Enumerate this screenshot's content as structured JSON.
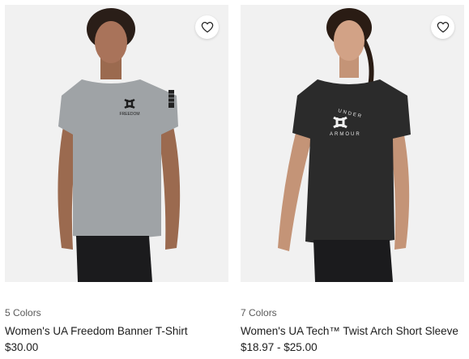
{
  "products": [
    {
      "colors_label": "5 Colors",
      "name": "Women's UA Freedom Banner T-Shirt",
      "price": "$30.00",
      "shirt_color": "#9fa3a6",
      "shirt_print": "FREEDOM",
      "wishlist_icon": "heart-icon"
    },
    {
      "colors_label": "7 Colors",
      "name": "Women's UA Tech™ Twist Arch Short Sleeve",
      "price": "$18.97 - $25.00",
      "shirt_color": "#2b2b2b",
      "shirt_print": [
        "UNDER",
        "ARMOUR"
      ],
      "wishlist_icon": "heart-icon"
    }
  ]
}
